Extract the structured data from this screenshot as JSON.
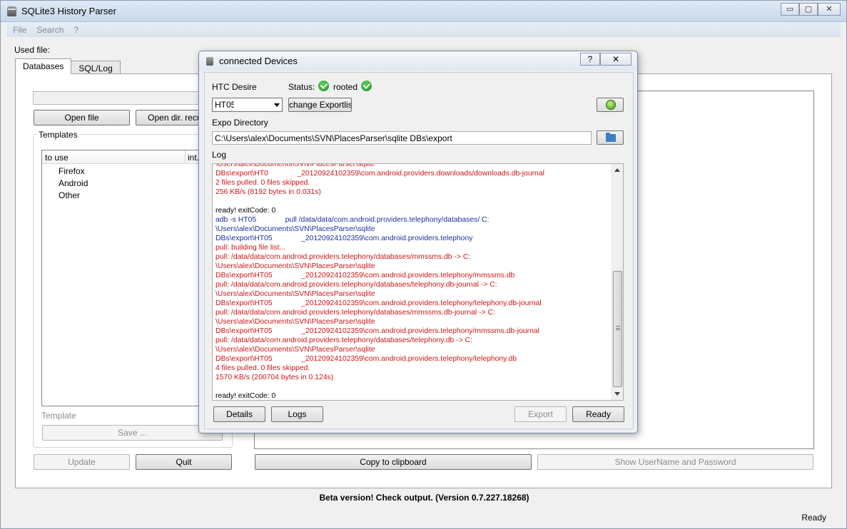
{
  "app": {
    "title": "SQLite3 History Parser",
    "window_controls": {
      "minimize": "▭",
      "maximize": "▢",
      "close": "✕"
    },
    "menu": [
      "File",
      "Search",
      "?"
    ],
    "used_file_label": "Used file:",
    "tabs": [
      "Databases",
      "SQL/Log"
    ],
    "buttons": {
      "open_file": "Open file",
      "open_dir": "Open dir. recursive",
      "save": "Save ...",
      "update": "Update",
      "quit": "Quit",
      "copy_clipboard": "Copy to clipboard",
      "show_credentials": "Show UserName and Password"
    },
    "templates": {
      "group_title": "Templates",
      "columns": [
        "to use",
        "int."
      ],
      "items": [
        "Firefox",
        "Android",
        "Other"
      ],
      "template_label": "Template"
    },
    "beta_notice": "Beta version! Check output. (Version 0.7.227.18268)",
    "status": "Ready"
  },
  "dialog": {
    "title": "connected Devices",
    "help": "?",
    "close": "✕",
    "device_name": "HTC Desire",
    "status_label": "Status:",
    "status_value": "rooted",
    "device_select_value": "HT05",
    "change_exportlist": "change Exportlist",
    "expo_directory_label": "Expo Directory",
    "expo_directory_value": "C:\\Users\\alex\\Documents\\SVN\\PlacesParser\\sqlite DBs\\export",
    "log_label": "Log",
    "log_lines": [
      {
        "text": "\\Users\\alex\\Documents\\SVN\\PlacesParser\\sqlite",
        "color": "red"
      },
      {
        "text": "DBs\\export\\HT0              _20120924102359\\com.android.providers.downloads/downloads.db-journal",
        "color": "red"
      },
      {
        "text": "2 files pulled. 0 files skipped.",
        "color": "red"
      },
      {
        "text": "256 KB/s (8192 bytes in 0.031s)",
        "color": "red"
      },
      {
        "text": " ",
        "color": "black"
      },
      {
        "text": "ready! exitCode: 0",
        "color": "black"
      },
      {
        "text": "adb -s HT05              pull /data/data/com.android.providers.telephony/databases/ C:",
        "color": "blue"
      },
      {
        "text": "\\Users\\alex\\Documents\\SVN\\PlacesParser\\sqlite",
        "color": "blue"
      },
      {
        "text": "DBs\\export\\HT05              _20120924102359\\com.android.providers.telephony",
        "color": "blue"
      },
      {
        "text": "pull: building file list...",
        "color": "red"
      },
      {
        "text": "pull: /data/data/com.android.providers.telephony/databases/mmssms.db -> C:",
        "color": "red"
      },
      {
        "text": "\\Users\\alex\\Documents\\SVN\\PlacesParser\\sqlite",
        "color": "red"
      },
      {
        "text": "DBs\\export\\HT05              _20120924102359\\com.android.providers.telephony/mmssms.db",
        "color": "red"
      },
      {
        "text": "pull: /data/data/com.android.providers.telephony/databases/telephony.db-journal -> C:",
        "color": "red"
      },
      {
        "text": "\\Users\\alex\\Documents\\SVN\\PlacesParser\\sqlite",
        "color": "red"
      },
      {
        "text": "DBs\\export\\HT05              _20120924102359\\com.android.providers.telephony/telephony.db-journal",
        "color": "red"
      },
      {
        "text": "pull: /data/data/com.android.providers.telephony/databases/mmssms.db-journal -> C:",
        "color": "red"
      },
      {
        "text": "\\Users\\alex\\Documents\\SVN\\PlacesParser\\sqlite",
        "color": "red"
      },
      {
        "text": "DBs\\export\\HT05              _20120924102359\\com.android.providers.telephony/mmssms.db-journal",
        "color": "red"
      },
      {
        "text": "pull: /data/data/com.android.providers.telephony/databases/telephony.db -> C:",
        "color": "red"
      },
      {
        "text": "\\Users\\alex\\Documents\\SVN\\PlacesParser\\sqlite",
        "color": "red"
      },
      {
        "text": "DBs\\export\\HT05              _20120924102359\\com.android.providers.telephony/telephony.db",
        "color": "red"
      },
      {
        "text": "4 files pulled. 0 files skipped.",
        "color": "red"
      },
      {
        "text": "1570 KB/s (200704 bytes in 0.124s)",
        "color": "red"
      },
      {
        "text": " ",
        "color": "black"
      },
      {
        "text": "ready! exitCode: 0",
        "color": "black"
      }
    ],
    "buttons": {
      "details": "Details",
      "logs": "Logs",
      "export": "Export",
      "ready": "Ready"
    },
    "colors": {
      "log_red": "#d01515",
      "log_blue": "#1b2fa0",
      "check_green": "#18901e"
    }
  }
}
